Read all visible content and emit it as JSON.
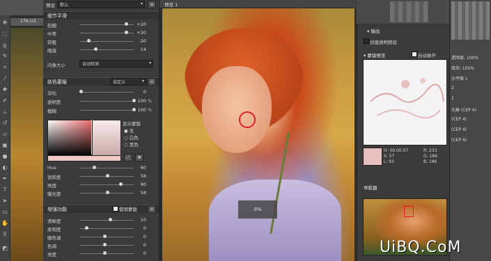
{
  "ps": {
    "doc_tab": "176.cr2",
    "tools": [
      "move",
      "marquee",
      "lasso",
      "quick-select",
      "crop",
      "eyedropper",
      "heal",
      "brush",
      "stamp",
      "history",
      "eraser",
      "gradient",
      "blur",
      "dodge",
      "pen",
      "type",
      "path",
      "shape",
      "hand",
      "zoom"
    ]
  },
  "panel": {
    "presets_label": "预设",
    "preset_value": "默认",
    "detail": {
      "title": "细节平滑",
      "sliders": [
        {
          "label": "较细",
          "value": "+20",
          "pos": 0.85
        },
        {
          "label": "中等",
          "value": "+20",
          "pos": 0.85
        },
        {
          "label": "较粗",
          "value": "-20",
          "pos": 0.15
        },
        {
          "label": "阈值",
          "value": "14",
          "pos": 0.28
        }
      ],
      "size_label": "内像大小",
      "size_value": "自动检测"
    },
    "skin_mask": {
      "title": "肤色蒙版",
      "mode": "自定义",
      "sliders": [
        {
          "label": "羽化",
          "value": "0",
          "pos": 0.0,
          "unit": ""
        },
        {
          "label": "透明度",
          "value": "100",
          "pos": 1.0,
          "unit": "%"
        },
        {
          "label": "模糊",
          "value": "100",
          "pos": 1.0,
          "unit": "%"
        }
      ],
      "show_mask_label": "显示蒙版",
      "radios": [
        "无",
        "白色",
        "黑色"
      ],
      "hsl": [
        {
          "label": "Hue",
          "value": "60",
          "pos": 0.25
        },
        {
          "label": "饱和度",
          "value": "58",
          "pos": 0.5
        },
        {
          "label": "亮度",
          "value": "90",
          "pos": 0.75
        },
        {
          "label": "曝光度",
          "value": "58",
          "pos": 0.5
        }
      ]
    },
    "enhance": {
      "title": "增强功能",
      "use_mask": "使用蒙版",
      "sliders": [
        {
          "label": "清晰度",
          "value": "10",
          "pos": 0.55
        },
        {
          "label": "柔和度",
          "value": "0",
          "pos": 0.1
        },
        {
          "label": "暖色调",
          "value": "0",
          "pos": 0.45
        },
        {
          "label": "色调",
          "value": "0",
          "pos": 0.45
        },
        {
          "label": "亮度",
          "value": "0",
          "pos": 0.45
        }
      ]
    }
  },
  "preview": {
    "tab": "预览 1",
    "progress": "0%"
  },
  "right": {
    "output_title": "输出",
    "create_layer": "创建透明图层",
    "mask_preview_title": "蒙版预览",
    "auto_expand": "自动展开",
    "info": {
      "H": "H: 00.00.07",
      "S": "S: 57",
      "L": "L: 93",
      "R": "R: 233",
      "G": "G: 186",
      "B": "B: 186"
    },
    "navigator_title": "导航器"
  },
  "layers": {
    "rows": [
      "透明度: 100%",
      "填充: 100%",
      "沙平面 1",
      "2",
      "1",
      "光晕 (CEP 4)",
      "(CEP 4)",
      "(CEP 4)",
      "(CEP 4)"
    ]
  },
  "watermark": "UiBQ.CoM"
}
